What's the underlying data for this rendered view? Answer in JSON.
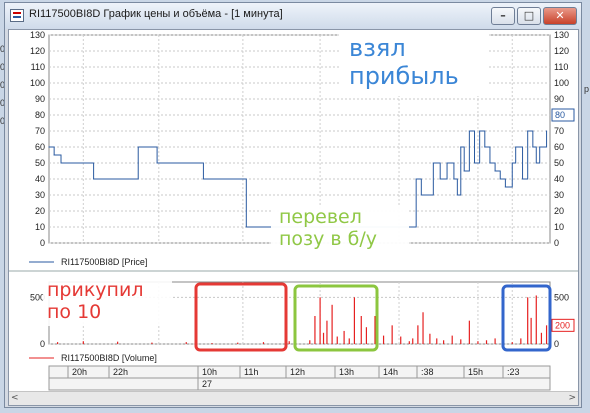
{
  "window": {
    "title": "RI117500BI8D График цены и объёма - [1 минута]",
    "minimize_label": "–",
    "maximize_label": "□",
    "close_label": "✕"
  },
  "edge_fragments": {
    "left": [
      "00",
      "00",
      "00",
      "00",
      "00"
    ],
    "right": [
      "р"
    ]
  },
  "annotations": {
    "took_profit": "взял\nприбыль",
    "moved_breakeven": "перевел\nпозу в б/у",
    "bought_more": "прикупил\nпо 10"
  },
  "colors": {
    "price_line": "#2a5aa0",
    "volume_bar": "#e62020",
    "box_red": "#e53935",
    "box_green": "#8cc63f",
    "box_blue": "#3366cc",
    "annotation_blue": "#3b86d6",
    "annotation_green": "#8cc63f",
    "annotation_red": "#e53935"
  },
  "chart_data": [
    {
      "type": "line",
      "name": "price",
      "legend": "RI117500BI8D [Price]",
      "yticks": [
        0,
        10,
        20,
        30,
        40,
        50,
        60,
        70,
        80,
        90,
        100,
        110,
        120,
        130
      ],
      "ylim": [
        0,
        130
      ],
      "current_value_label": "80",
      "series": [
        {
          "name": "RI117500BI8D [Price]",
          "x": [
            0,
            3,
            7,
            17,
            23,
            24,
            26,
            48,
            52,
            63,
            90,
            100,
            115,
            123,
            128,
            130,
            138,
            145,
            148,
            150,
            152,
            162,
            168,
            176,
            183,
            188,
            193,
            196,
            200,
            205,
            210,
            214,
            217,
            220,
            224,
            228,
            232,
            236,
            238,
            240,
            242,
            245,
            248,
            251,
            254,
            257,
            260,
            263,
            266,
            270,
            272,
            276,
            279,
            282,
            284,
            286,
            290
          ],
          "values": [
            60,
            55,
            50,
            50,
            50,
            50,
            40,
            40,
            60,
            50,
            40,
            40,
            10,
            10,
            10,
            10,
            10,
            10,
            10,
            10,
            10,
            10,
            10,
            10,
            10,
            10,
            10,
            10,
            10,
            10,
            10,
            40,
            30,
            30,
            50,
            40,
            50,
            40,
            30,
            60,
            45,
            70,
            50,
            70,
            60,
            50,
            45,
            40,
            35,
            50,
            60,
            40,
            70,
            60,
            50,
            60,
            70
          ]
        }
      ]
    },
    {
      "type": "bar",
      "name": "volume",
      "legend": "RI117500BI8D [Volume]",
      "yticks": [
        0,
        500
      ],
      "ylim": [
        0,
        600
      ],
      "current_value_label": "200",
      "series": [
        {
          "name": "RI117500BI8D [Volume]",
          "x": [
            5,
            20,
            40,
            60,
            80,
            95,
            110,
            125,
            140,
            152,
            155,
            158,
            160,
            162,
            165,
            168,
            172,
            175,
            178,
            182,
            185,
            190,
            195,
            200,
            205,
            210,
            212,
            215,
            218,
            222,
            226,
            230,
            235,
            240,
            245,
            250,
            255,
            260,
            265,
            270,
            275,
            279,
            281,
            284,
            287,
            290
          ],
          "values": [
            20,
            30,
            25,
            15,
            20,
            10,
            15,
            20,
            30,
            40,
            300,
            500,
            120,
            250,
            420,
            80,
            140,
            60,
            500,
            300,
            180,
            300,
            90,
            200,
            80,
            30,
            60,
            200,
            340,
            110,
            60,
            40,
            90,
            50,
            250,
            30,
            40,
            60,
            40,
            20,
            60,
            500,
            280,
            520,
            120,
            200
          ]
        }
      ]
    }
  ],
  "time_axis": {
    "labels": [
      "20h",
      "22h",
      "10h",
      "11h",
      "12h",
      "13h",
      "14h",
      ":38",
      "15h",
      ":23"
    ],
    "date_label": "27"
  }
}
